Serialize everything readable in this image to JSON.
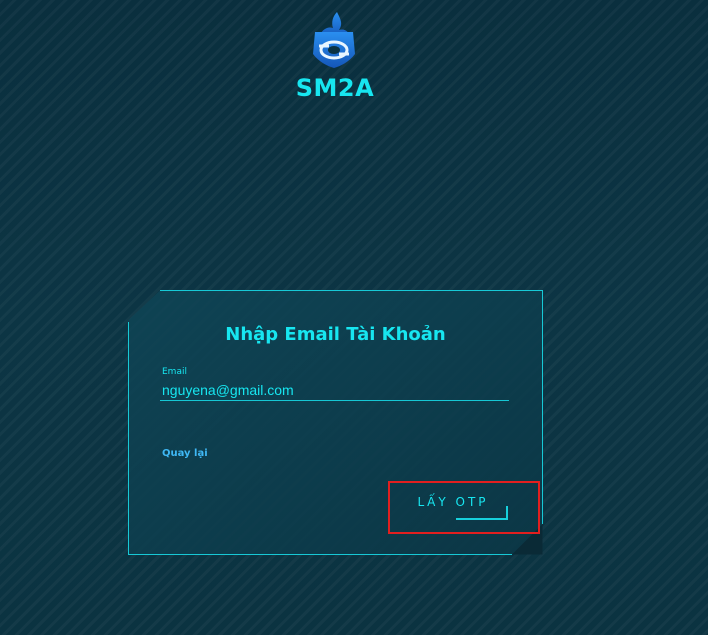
{
  "brand": {
    "name": "SM2A",
    "logo_icon": "sm2a-logo-icon",
    "accent_color": "#17e6f0",
    "logo_color": "#1f7ae0"
  },
  "card": {
    "title": "Nhập Email Tài Khoản",
    "email_label": "Email",
    "email_value": "nguyena@gmail.com",
    "back_link": "Quay lại",
    "submit_label": "LẤY OTP",
    "highlight_color": "#e21f1f"
  }
}
